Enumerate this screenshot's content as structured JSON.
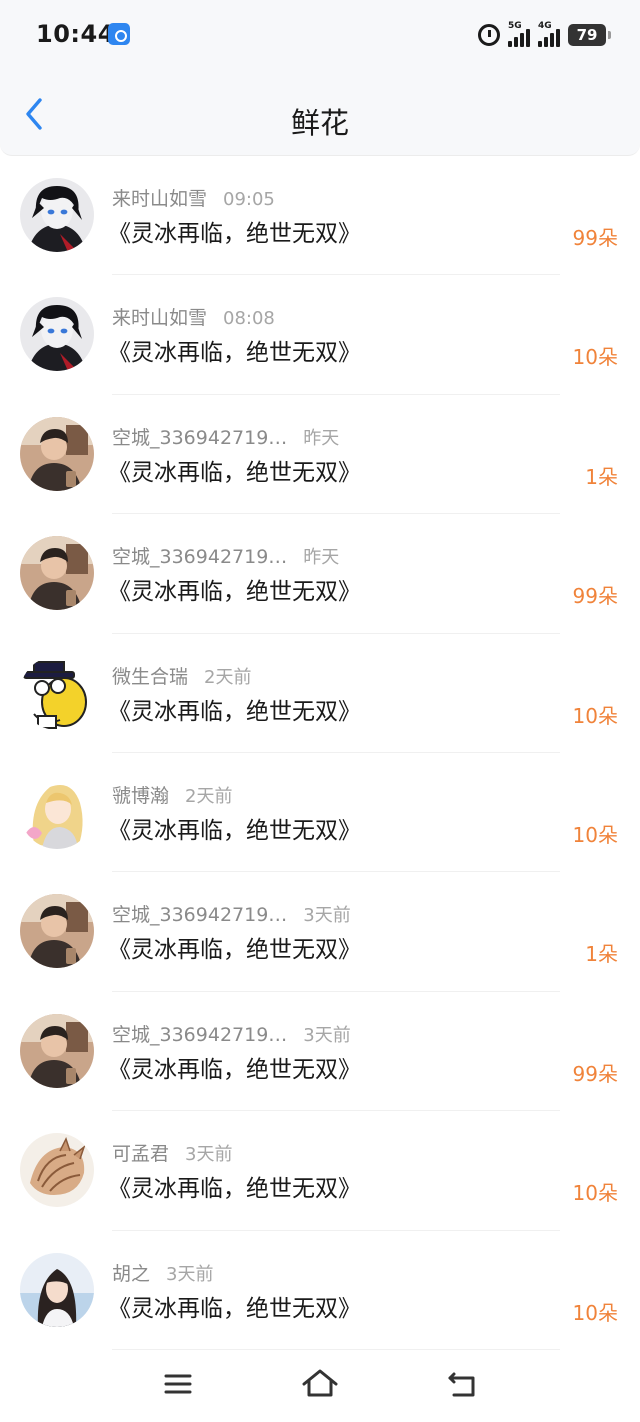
{
  "status_bar": {
    "time": "10:44",
    "network_1": "5G",
    "network_2": "4G",
    "battery": "79"
  },
  "header": {
    "title": "鲜花"
  },
  "items": [
    {
      "user": "来时山如雪",
      "time": "09:05",
      "book": "《灵冰再临，绝世无双》",
      "count": "99朵",
      "avatar": "anime-boy-dark"
    },
    {
      "user": "来时山如雪",
      "time": "08:08",
      "book": "《灵冰再临，绝世无双》",
      "count": "10朵",
      "avatar": "anime-boy-dark"
    },
    {
      "user": "空城_336942719…",
      "time": "昨天",
      "book": "《灵冰再临，绝世无双》",
      "count": "1朵",
      "avatar": "photo-person"
    },
    {
      "user": "空城_336942719…",
      "time": "昨天",
      "book": "《灵冰再临，绝世无双》",
      "count": "99朵",
      "avatar": "photo-person"
    },
    {
      "user": "微生合瑞",
      "time": "2天前",
      "book": "《灵冰再临，绝世无双》",
      "count": "10朵",
      "avatar": "cartoon-hat"
    },
    {
      "user": "虢博瀚",
      "time": "2天前",
      "book": "《灵冰再临，绝世无双》",
      "count": "10朵",
      "avatar": "anime-girl"
    },
    {
      "user": "空城_336942719…",
      "time": "3天前",
      "book": "《灵冰再临，绝世无双》",
      "count": "1朵",
      "avatar": "photo-person"
    },
    {
      "user": "空城_336942719…",
      "time": "3天前",
      "book": "《灵冰再临，绝世无双》",
      "count": "99朵",
      "avatar": "photo-person"
    },
    {
      "user": "可孟君",
      "time": "3天前",
      "book": "《灵冰再临，绝世无双》",
      "count": "10朵",
      "avatar": "seashell"
    },
    {
      "user": "胡之",
      "time": "3天前",
      "book": "《灵冰再临，绝世无双》",
      "count": "10朵",
      "avatar": "photo-girl"
    }
  ],
  "colors": {
    "accent": "#2e86f0",
    "count": "#f0833a",
    "username": "#8a8a8a",
    "timestamp": "#a6a6a6"
  },
  "bottom_nav": {
    "icons": [
      "menu-icon",
      "home-icon",
      "back-icon"
    ]
  }
}
